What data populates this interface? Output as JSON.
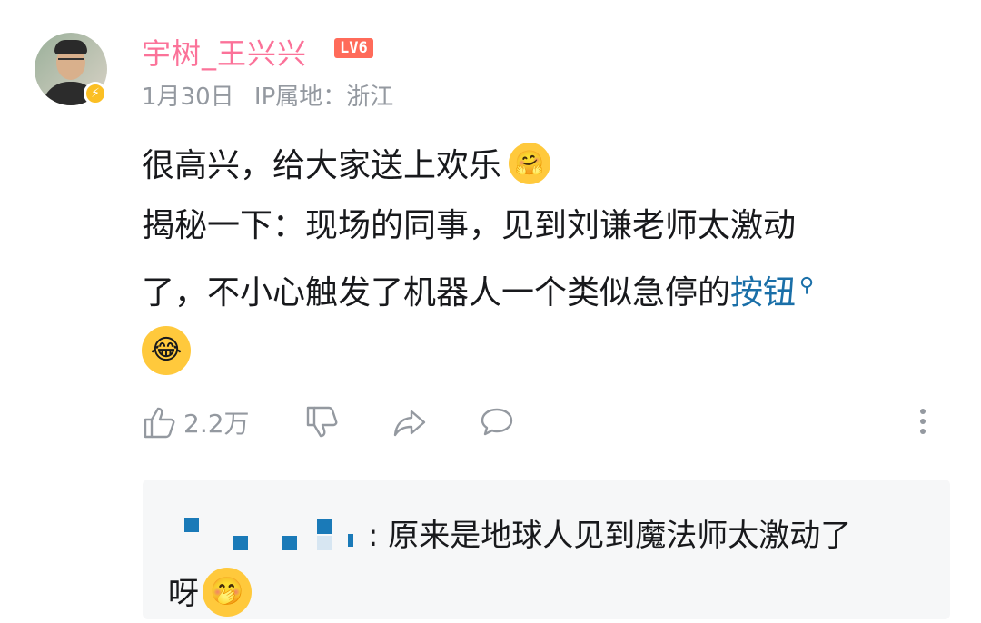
{
  "user": {
    "name": "宇树_王兴兴",
    "level": "LV6",
    "date": "1月30日",
    "ip_location": "IP属地：浙江"
  },
  "comment": {
    "line1": "很高兴，给大家送上欢乐",
    "line2": "揭秘一下：现场的同事，见到刘谦老师太激动",
    "line3_prefix": "了，不小心触发了机器人一个类似急停的",
    "line3_link": "按钮",
    "emoji1": "hug-emoji",
    "emoji2": "laugh-cry-emoji"
  },
  "actions": {
    "like_count": "2.2万"
  },
  "reply": {
    "text_line1": ": 原来是地球人见到魔法师太激动了",
    "text_line2": "呀"
  },
  "colors": {
    "username": "#fb7299",
    "link": "#1a6fa8",
    "level_badge": "#ff6b5a",
    "meta": "#9499a0",
    "reply_bg": "#f6f7f8"
  }
}
